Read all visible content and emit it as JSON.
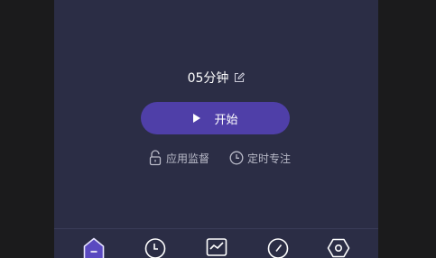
{
  "timer": {
    "value": "05分钟"
  },
  "start_button": {
    "label": "开始"
  },
  "links": [
    {
      "label": "应用监督",
      "icon": "lock-icon"
    },
    {
      "label": "定时专注",
      "icon": "clock-icon"
    }
  ],
  "bottom_nav": [
    {
      "icon": "home-icon",
      "active": true
    },
    {
      "icon": "clock-icon",
      "active": false
    },
    {
      "icon": "chart-icon",
      "active": false
    },
    {
      "icon": "compass-icon",
      "active": false
    },
    {
      "icon": "settings-icon",
      "active": false
    }
  ],
  "colors": {
    "background": "#2b2d45",
    "accent": "#4f3fa8",
    "text": "#ffffff",
    "muted_text": "#b9bac8"
  }
}
